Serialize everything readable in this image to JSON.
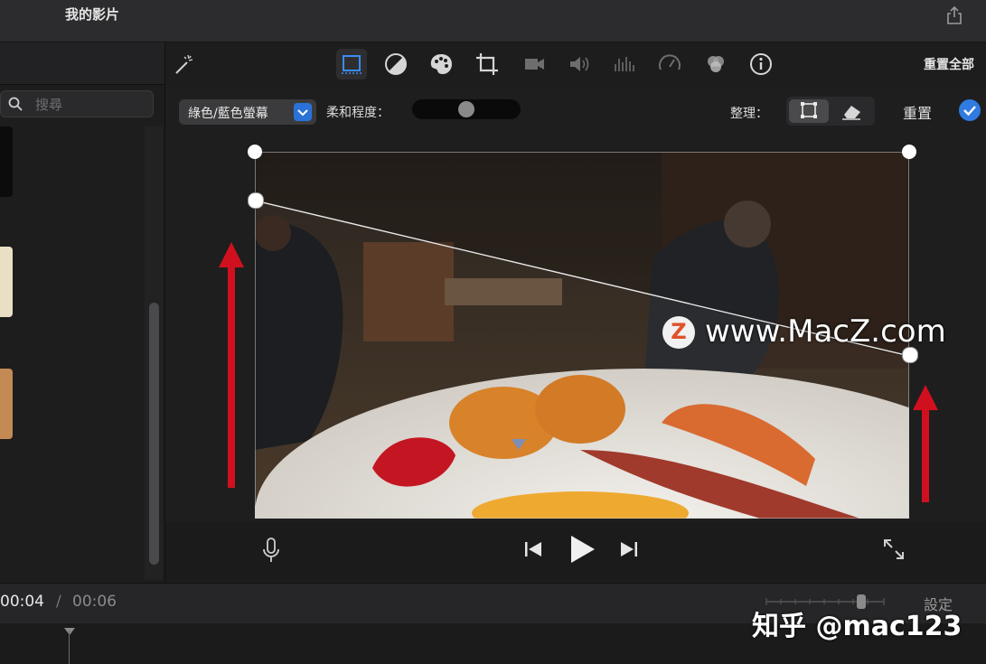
{
  "window": {
    "title": "我的影片"
  },
  "sidebar": {
    "search_placeholder": "搜尋"
  },
  "toolbar": {
    "tools": [
      {
        "name": "magic-wand-icon"
      },
      {
        "name": "crop-frame-icon",
        "active": true
      },
      {
        "name": "color-balance-icon"
      },
      {
        "name": "color-palette-icon"
      },
      {
        "name": "crop-icon"
      },
      {
        "name": "stabilization-camera-icon"
      },
      {
        "name": "volume-icon"
      },
      {
        "name": "equalizer-icon"
      },
      {
        "name": "speed-gauge-icon"
      },
      {
        "name": "filter-circles-icon"
      },
      {
        "name": "info-icon"
      }
    ],
    "reset_all": "重置全部"
  },
  "controls": {
    "mode": "綠色/藍色螢幕",
    "softness_label": "柔和程度：",
    "softness_value": 0.5,
    "tidy_label": "整理：",
    "reset": "重置"
  },
  "viewer": {
    "watermark": "www.MacZ.com",
    "watermark_logo": "Z"
  },
  "timeline": {
    "current": "00:04",
    "separator": "/",
    "total": "00:06",
    "settings": "設定"
  },
  "overlay": {
    "credit": "知乎 @mac123"
  },
  "colors": {
    "accent": "#2f7be0",
    "arrow": "#d0101e"
  }
}
